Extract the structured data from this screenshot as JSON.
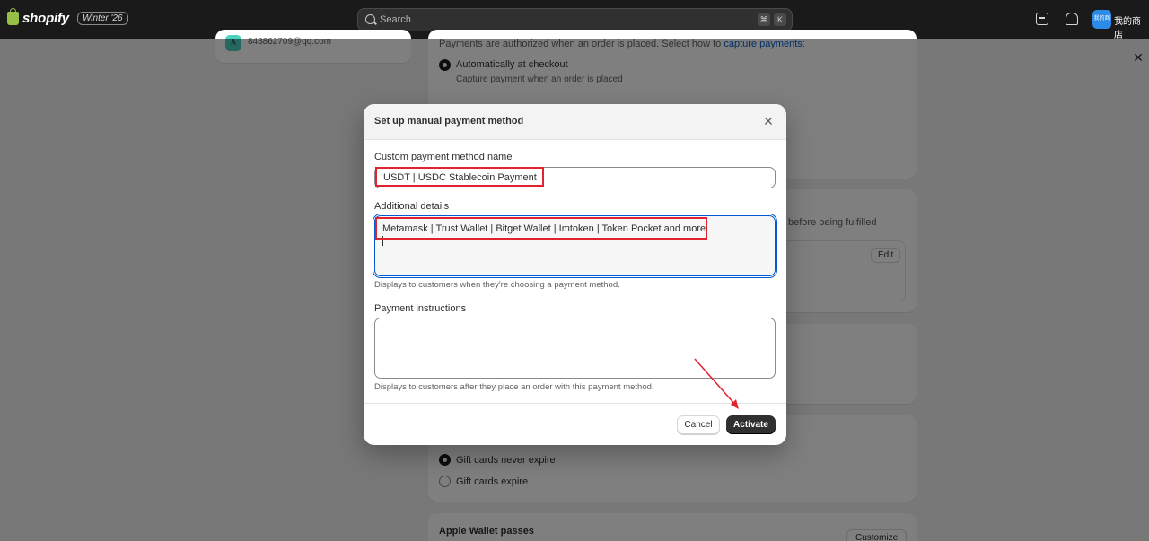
{
  "topbar": {
    "logo_text": "shopify",
    "version_badge": "Winter '26",
    "search_placeholder": "Search",
    "shortcut_cmd": "⌘",
    "shortcut_key": "K",
    "avatar_text": "我的商店",
    "store_name": "我的商店"
  },
  "user": {
    "avatar_letter": "A",
    "email": "843862709@qq.com"
  },
  "background": {
    "auth_text": "Payments are authorized when an order is placed. Select how to ",
    "auth_link": "capture payments",
    "auth_suffix": ":",
    "option_auto": "Automatically at checkout",
    "option_auto_sub": "Capture payment when an order is placed",
    "fulfilled_text": "before being fulfilled",
    "edit_label": "Edit",
    "gift_never": "Gift cards never expire",
    "gift_expire": "Gift cards expire",
    "apple_title": "Apple Wallet passes",
    "customize_label": "Customize",
    "close_side": "✕"
  },
  "modal": {
    "title": "Set up manual payment method",
    "close": "✕",
    "name_label": "Custom payment method name",
    "name_value": "USDT | USDC Stablecoin Payment",
    "details_label": "Additional details",
    "details_value": "Metamask | Trust Wallet | Bitget Wallet | Imtoken | Token Pocket and more",
    "details_help": "Displays to customers when they're choosing a payment method.",
    "instructions_label": "Payment instructions",
    "instructions_value": "",
    "instructions_help": "Displays to customers after they place an order with this payment method.",
    "cancel_label": "Cancel",
    "activate_label": "Activate"
  },
  "colors": {
    "annotation_red": "#e0232f",
    "focus_blue": "#005bd3",
    "primary_button": "#303030"
  }
}
